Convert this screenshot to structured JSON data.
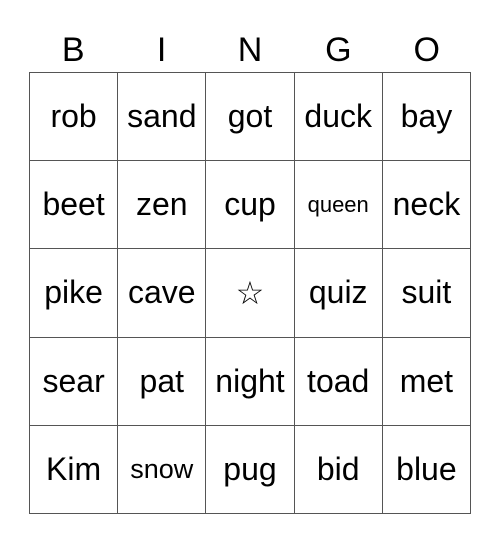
{
  "header": [
    "B",
    "I",
    "N",
    "G",
    "O"
  ],
  "cells": [
    [
      "rob",
      "sand",
      "got",
      "duck",
      "bay"
    ],
    [
      "beet",
      "zen",
      "cup",
      "queen",
      "neck"
    ],
    [
      "pike",
      "cave",
      "☆",
      "quiz",
      "suit"
    ],
    [
      "sear",
      "pat",
      "night",
      "toad",
      "met"
    ],
    [
      "Kim",
      "snow",
      "pug",
      "bid",
      "blue"
    ]
  ],
  "free_space_icon": "star-outline"
}
